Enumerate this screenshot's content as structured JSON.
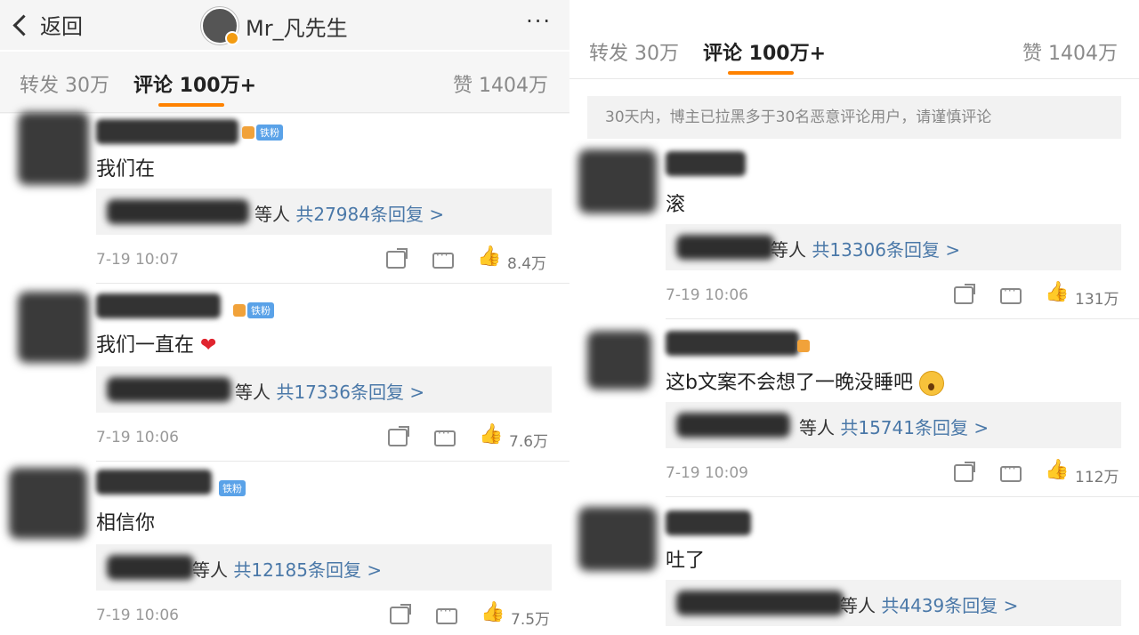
{
  "header": {
    "back_label": "返回",
    "title": "Mr_凡先生",
    "more": "···"
  },
  "tabs": {
    "repost": "转发 30万",
    "comments": "评论 100万+",
    "likes": "赞 1404万"
  },
  "notice": "30天内，博主已拉黑多于30名恶意评论用户，请谨慎评论",
  "left_comments": [
    {
      "text": "我们在",
      "badge": "铁粉",
      "reply_suffix": "等人",
      "reply_link": "共27984条回复 >",
      "time": "7-19 10:07",
      "likes": "8.4万"
    },
    {
      "text": "我们一直在",
      "badge": "铁粉",
      "reply_suffix": "等人",
      "reply_link": "共17336条回复 >",
      "time": "7-19 10:06",
      "likes": "7.6万"
    },
    {
      "text": "相信你",
      "badge": "铁粉",
      "reply_suffix": "等人",
      "reply_link": "共12185条回复 >",
      "time": "7-19 10:06",
      "likes": "7.5万"
    }
  ],
  "right_comments": [
    {
      "text": "滚",
      "reply_suffix": "等人",
      "reply_link": "共13306条回复 >",
      "time": "7-19 10:06",
      "likes": "131万"
    },
    {
      "text": "这b文案不会想了一晚没睡吧",
      "reply_suffix": "等人",
      "reply_link": "共15741条回复 >",
      "time": "7-19 10:09",
      "likes": "112万"
    },
    {
      "text": "吐了",
      "reply_suffix": "等人",
      "reply_link": "共4439条回复 >"
    }
  ],
  "icons": {
    "heart": "❤",
    "like": "👍"
  },
  "colors": {
    "accent": "#ff8200",
    "link": "#4a78a8",
    "badge": "#5aa2e8"
  }
}
